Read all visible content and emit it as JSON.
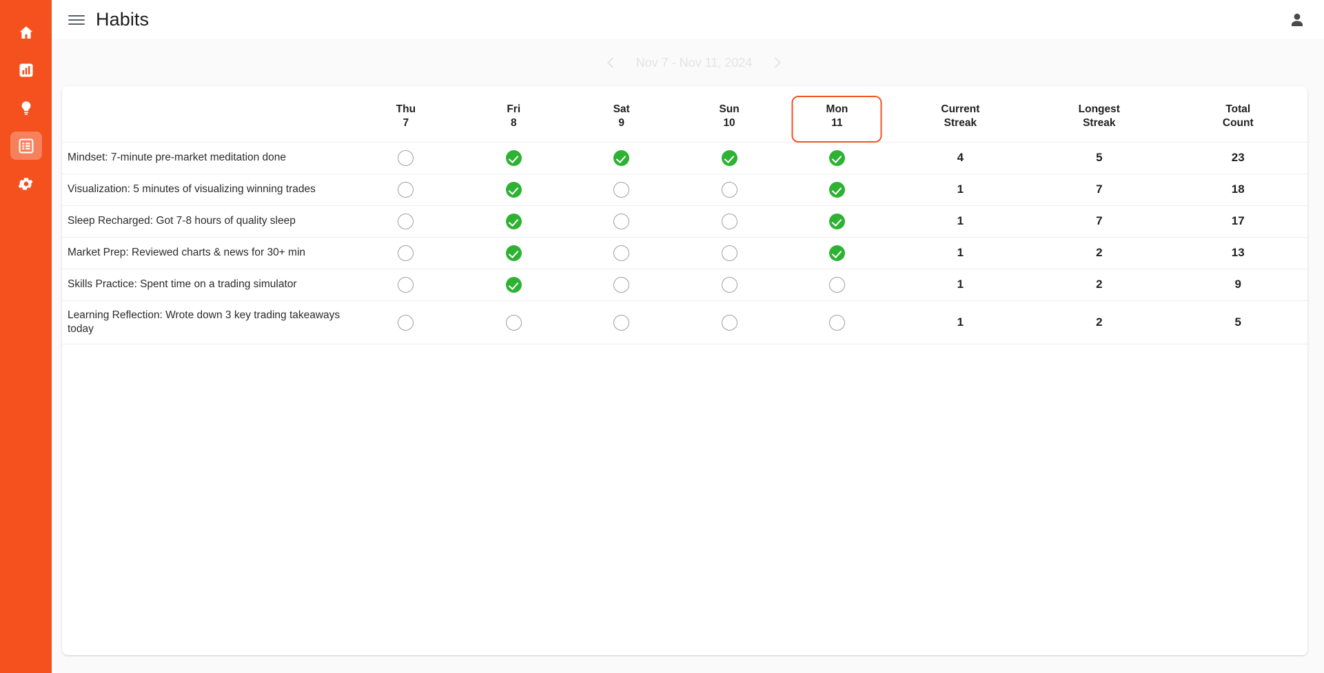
{
  "sidebar": {
    "background": "#F4511E",
    "active_background": "rgba(255,255,255,0.28)",
    "items": [
      {
        "id": "home",
        "icon": "home-icon",
        "label": "Home",
        "active": false
      },
      {
        "id": "analytics",
        "icon": "bar-chart-icon",
        "label": "Analytics",
        "active": false
      },
      {
        "id": "insights",
        "icon": "lightbulb-icon",
        "label": "Insights",
        "active": false
      },
      {
        "id": "habits",
        "icon": "table-list-icon",
        "label": "Habits",
        "active": true
      },
      {
        "id": "settings",
        "icon": "gear-icon",
        "label": "Settings",
        "active": false
      }
    ]
  },
  "topbar": {
    "menu_icon": "hamburger-menu-icon",
    "title": "Habits",
    "account_icon": "person-account-icon"
  },
  "date_nav": {
    "prev_icon": "chevron-left-icon",
    "next_icon": "chevron-right-icon",
    "range_label": "Nov 7 - Nov 11, 2024",
    "opacity": "0.10"
  },
  "table": {
    "accent_color": "#F4511E",
    "done_color": "#2EB233",
    "empty_color": "#9e9e9e",
    "headers": {
      "habit": "",
      "days": [
        {
          "weekday": "Thu",
          "daynum": "7",
          "today": false
        },
        {
          "weekday": "Fri",
          "daynum": "8",
          "today": false
        },
        {
          "weekday": "Sat",
          "daynum": "9",
          "today": false
        },
        {
          "weekday": "Sun",
          "daynum": "10",
          "today": false
        },
        {
          "weekday": "Mon",
          "daynum": "11",
          "today": true
        }
      ],
      "stats": [
        {
          "line1": "Current",
          "line2": "Streak"
        },
        {
          "line1": "Longest",
          "line2": "Streak"
        },
        {
          "line1": "Total",
          "line2": "Count"
        }
      ]
    },
    "rows": [
      {
        "name": "Mindset: 7-minute pre-market meditation done",
        "checks": [
          false,
          true,
          true,
          true,
          true
        ],
        "current_streak": "4",
        "longest_streak": "5",
        "total_count": "23"
      },
      {
        "name": "Visualization: 5 minutes of visualizing winning trades",
        "checks": [
          false,
          true,
          false,
          false,
          true
        ],
        "current_streak": "1",
        "longest_streak": "7",
        "total_count": "18"
      },
      {
        "name": "Sleep Recharged: Got 7-8 hours of quality sleep",
        "checks": [
          false,
          true,
          false,
          false,
          true
        ],
        "current_streak": "1",
        "longest_streak": "7",
        "total_count": "17"
      },
      {
        "name": "Market Prep: Reviewed charts & news for 30+ min",
        "checks": [
          false,
          true,
          false,
          false,
          true
        ],
        "current_streak": "1",
        "longest_streak": "2",
        "total_count": "13"
      },
      {
        "name": "Skills Practice: Spent time on a trading simulator",
        "checks": [
          false,
          true,
          false,
          false,
          false
        ],
        "current_streak": "1",
        "longest_streak": "2",
        "total_count": "9"
      },
      {
        "name": "Learning Reflection: Wrote down 3 key trading takeaways today",
        "checks": [
          false,
          false,
          false,
          false,
          false
        ],
        "current_streak": "1",
        "longest_streak": "2",
        "total_count": "5"
      }
    ]
  }
}
